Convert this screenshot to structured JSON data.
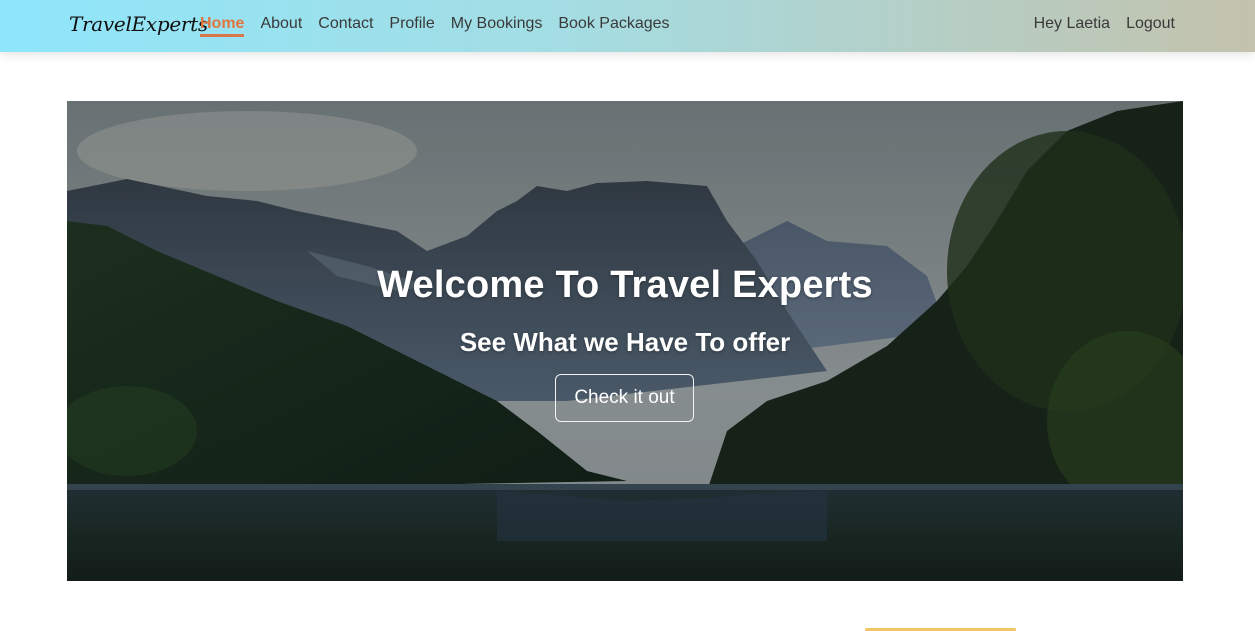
{
  "navbar": {
    "brand": "TravelExperts",
    "links": [
      {
        "label": "Home",
        "active": true
      },
      {
        "label": "About",
        "active": false
      },
      {
        "label": "Contact",
        "active": false
      },
      {
        "label": "Profile",
        "active": false
      },
      {
        "label": "My Bookings",
        "active": false
      },
      {
        "label": "Book Packages",
        "active": false
      }
    ],
    "greeting": "Hey Laetia",
    "logout": "Logout",
    "accent_color": "#e2743f"
  },
  "hero": {
    "title": "Welcome To Travel Experts",
    "subtitle": "See What we Have To offer",
    "button_label": "Check it out"
  }
}
